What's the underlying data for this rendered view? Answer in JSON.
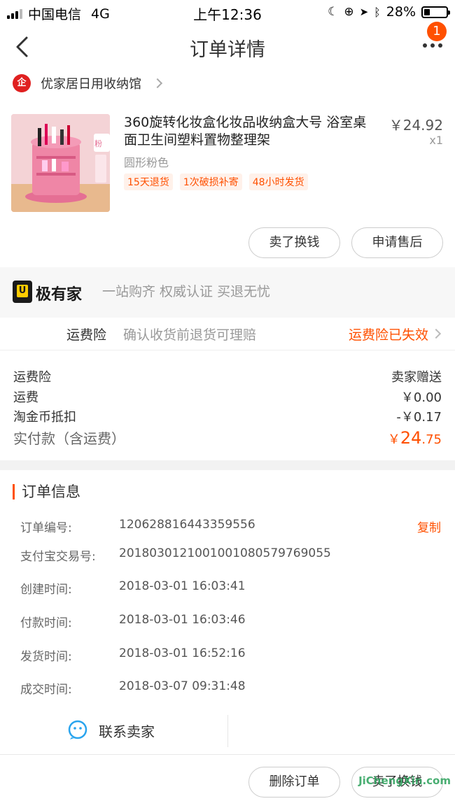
{
  "status_bar": {
    "carrier": "中国电信",
    "network": "4G",
    "time": "上午12:36",
    "battery": "28%"
  },
  "navbar": {
    "title": "订单详情",
    "badge_count": "1"
  },
  "shop": {
    "name": "优家居日用收纳馆"
  },
  "product": {
    "title": "360旋转化妆盒化妆品收纳盒大号 浴室桌面卫生间塑料置物整理架",
    "price": "￥24.92",
    "qty": "x1",
    "spec": "圆形粉色",
    "tags": [
      "15天退货",
      "1次破损补寄",
      "48小时发货"
    ]
  },
  "actions": {
    "sell": "卖了换钱",
    "after_sale": "申请售后"
  },
  "jiyoujia": {
    "name": "极有家",
    "slogan": "一站购齐 权威认证 买退无忧"
  },
  "insurance": {
    "label": "运费险",
    "desc": "确认收货前退货可理赔",
    "status": "运费险已失效"
  },
  "costs": {
    "rows": [
      {
        "label": "运费险",
        "value": "卖家赠送"
      },
      {
        "label": "运费",
        "value": "￥0.00"
      },
      {
        "label": "淘金币抵扣",
        "value": "-￥0.17"
      }
    ],
    "total_label": "实付款（含运费）",
    "total_currency": "￥",
    "total_int": "24",
    "total_dec": ".75"
  },
  "order_info": {
    "title": "订单信息",
    "rows": [
      {
        "label": "订单编号:",
        "value": "120628816443359556"
      },
      {
        "label": "支付宝交易号:",
        "value": "2018030121001001080579769055"
      },
      {
        "label": "创建时间:",
        "value": "2018-03-01 16:03:41"
      },
      {
        "label": "付款时间:",
        "value": "2018-03-01 16:03:46"
      },
      {
        "label": "发货时间:",
        "value": "2018-03-01 16:52:16"
      },
      {
        "label": "成交时间:",
        "value": "2018-03-07 09:31:48"
      }
    ],
    "copy": "复制",
    "contact": "联系卖家"
  },
  "bottom_bar": {
    "delete": "删除订单",
    "sell": "卖了换钱"
  },
  "watermark": "JiChengXin.com",
  "colors": {
    "accent": "#ff5000"
  }
}
